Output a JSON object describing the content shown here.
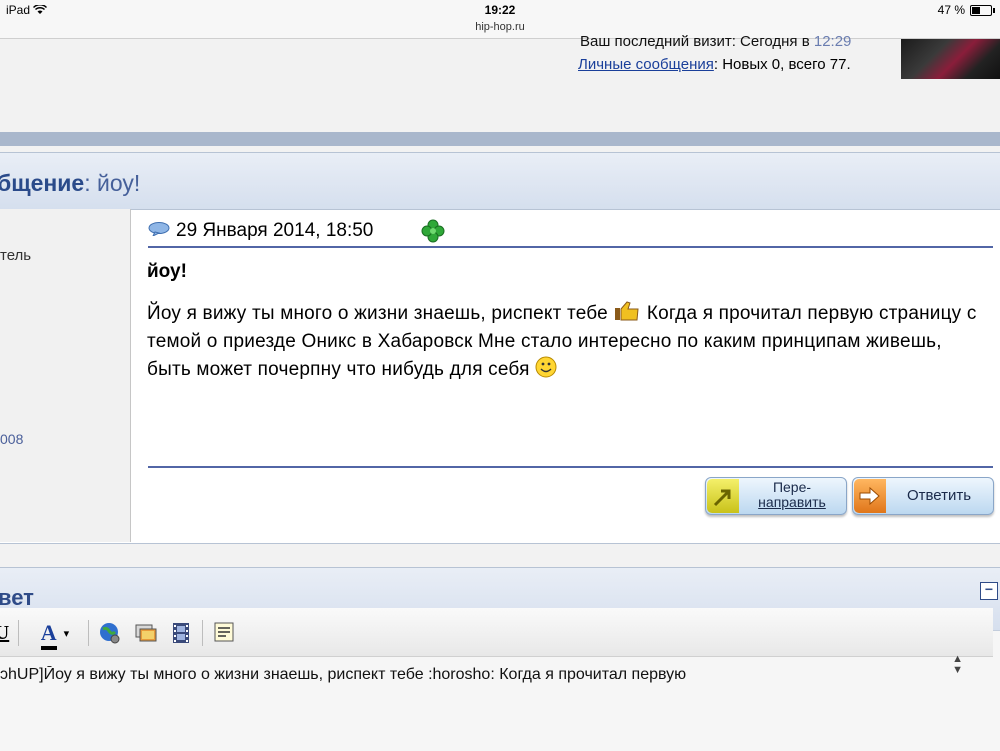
{
  "status_bar": {
    "device": "iPad",
    "time": "19:22",
    "url": "hip-hop.ru",
    "battery": "47 %",
    "battery_level": 0.47
  },
  "header": {
    "last_visit_text": "Ваш последний визит: Сегодня в",
    "last_visit_time": "12:29",
    "pm_link": "Личные сообщения",
    "pm_counts": ": Новых 0, всего 77."
  },
  "message": {
    "title_label": "бщение",
    "title_value": ": йоу!",
    "author_role": "тель",
    "author_year": "008",
    "date": "29 Января 2014, 18:50",
    "subject": "йоу!",
    "body_parts": {
      "part1": "Йоу я вижу ты много о жизни знаешь, риспект тебе ",
      "part2": " Когда я прочитал первую страницу с темой о приезде Оникс в Хабаровск Мне стало интересно по каким принципам живешь, быть может почерпну что нибудь для себя "
    },
    "buttons": {
      "forward_line1": "Пере-",
      "forward_line2": "направить",
      "reply": "Ответить"
    }
  },
  "reply": {
    "title": "вет",
    "collapse_symbol": "−",
    "toolbar": {
      "underline": "U",
      "font_color": "A",
      "color_caret": "▾"
    },
    "textarea_value": "ɔhUP]Йоу я вижу ты много о жизни знаешь, риспект тебе :horosho: Когда я прочитал первую"
  }
}
